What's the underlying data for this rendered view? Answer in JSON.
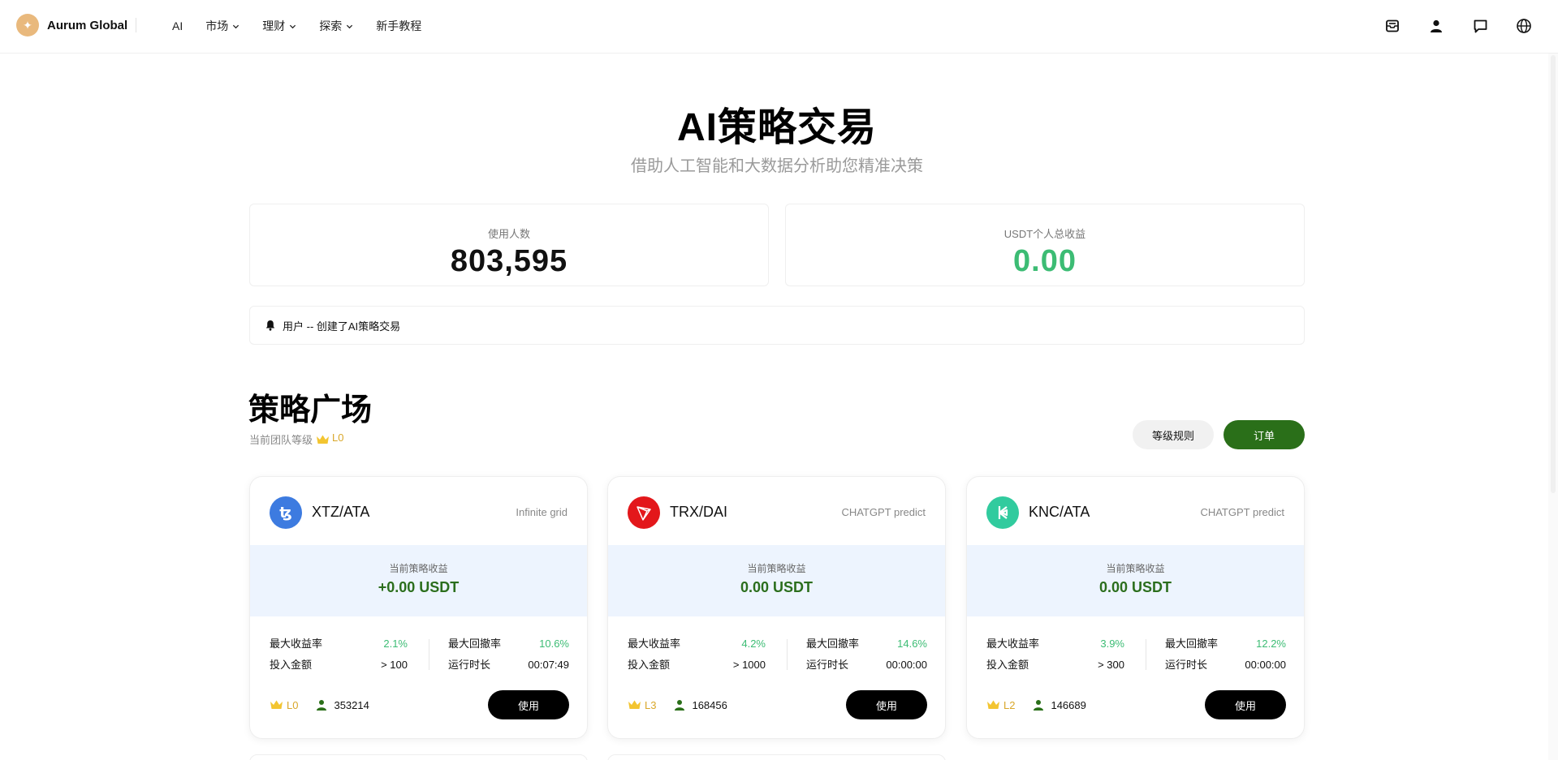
{
  "brand": {
    "name": "Aurum Global",
    "logo_glyph": "✦"
  },
  "nav": {
    "items": [
      {
        "label": "AI",
        "dropdown": false
      },
      {
        "label": "市场",
        "dropdown": true
      },
      {
        "label": "理财",
        "dropdown": true
      },
      {
        "label": "探索",
        "dropdown": true
      },
      {
        "label": "新手教程",
        "dropdown": false
      }
    ],
    "right_icons": [
      "mail-icon",
      "user-icon",
      "chat-icon",
      "globe-icon"
    ]
  },
  "hero": {
    "title": "AI策略交易",
    "subtitle": "借助人工智能和大数据分析助您精准决策"
  },
  "stats": {
    "users_label": "使用人数",
    "users_value": "803,595",
    "earnings_label": "USDT个人总收益",
    "earnings_value": "0.00"
  },
  "notice": {
    "text": "用户 -- 创建了AI策略交易"
  },
  "plaza": {
    "title": "策略广场",
    "team_level_label": "当前团队等级",
    "team_level": "L0",
    "rules_button": "等级规则",
    "orders_button": "订单"
  },
  "cards": [
    {
      "pair": "XTZ/ATA",
      "algo": "Infinite grid",
      "coin_icon": "tezos-icon",
      "coin_color": "#3d7be0",
      "profit_label": "当前策略收益",
      "profit_value": "+0.00 USDT",
      "max_return_label": "最大收益率",
      "max_return": "2.1%",
      "max_drawdown_label": "最大回撤率",
      "max_drawdown": "10.6%",
      "invest_label": "投入金额",
      "invest": "> 100",
      "runtime_label": "运行时长",
      "runtime": "00:07:49",
      "level": "L0",
      "users": "353214",
      "use_button": "使用"
    },
    {
      "pair": "TRX/DAI",
      "algo": "CHATGPT predict",
      "coin_icon": "tron-icon",
      "coin_color": "#e3171b",
      "profit_label": "当前策略收益",
      "profit_value": "0.00 USDT",
      "max_return_label": "最大收益率",
      "max_return": "4.2%",
      "max_drawdown_label": "最大回撤率",
      "max_drawdown": "14.6%",
      "invest_label": "投入金额",
      "invest": "> 1000",
      "runtime_label": "运行时长",
      "runtime": "00:00:00",
      "level": "L3",
      "users": "168456",
      "use_button": "使用"
    },
    {
      "pair": "KNC/ATA",
      "algo": "CHATGPT predict",
      "coin_icon": "kyber-icon",
      "coin_color": "#31cb9e",
      "profit_label": "当前策略收益",
      "profit_value": "0.00 USDT",
      "max_return_label": "最大收益率",
      "max_return": "3.9%",
      "max_drawdown_label": "最大回撤率",
      "max_drawdown": "12.2%",
      "invest_label": "投入金额",
      "invest": "> 300",
      "runtime_label": "运行时长",
      "runtime": "00:00:00",
      "level": "L2",
      "users": "146689",
      "use_button": "使用"
    }
  ],
  "colors": {
    "accent_green": "#2a6f19",
    "profit_green": "#3cbc74",
    "gold": "#d9a72a",
    "band_blue": "#edf4fe"
  }
}
